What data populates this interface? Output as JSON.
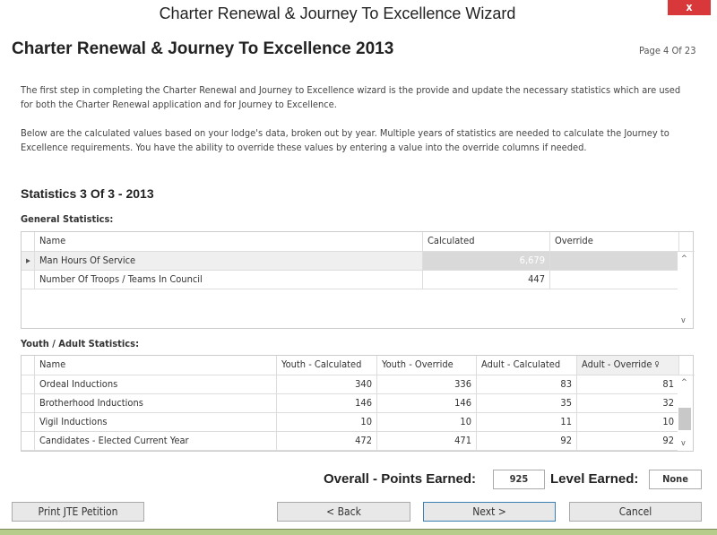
{
  "window": {
    "title": "Charter Renewal & Journey To Excellence Wizard",
    "close": "x"
  },
  "header": {
    "title": "Charter Renewal & Journey To Excellence 2013",
    "page": "Page 4 Of 23"
  },
  "intro": [
    "The first step in completing the Charter Renewal and Journey to Excellence wizard is the provide and update the necessary statistics which are used for both the Charter Renewal application and for Journey to Excellence.",
    "Below are the calculated values based on your lodge's data, broken out by year. Multiple years of statistics are needed to calculate the Journey to Excellence requirements. You have the ability to override these values by entering a value into the override columns if needed."
  ],
  "section": "Statistics 3 Of 3 - 2013",
  "general": {
    "label": "General Statistics:",
    "columns": [
      "Name",
      "Calculated",
      "Override"
    ],
    "rows": [
      {
        "name": "Man Hours Of Service",
        "calc": "6,679",
        "override": ""
      },
      {
        "name": "Number Of Troops / Teams In Council",
        "calc": "447",
        "override": ""
      }
    ]
  },
  "youth": {
    "label": "Youth / Adult Statistics:",
    "columns": [
      "Name",
      "Youth - Calculated",
      "Youth - Override",
      "Adult - Calculated",
      "Adult - Override"
    ],
    "rows": [
      [
        "Ordeal Inductions",
        "340",
        "336",
        "83",
        "81"
      ],
      [
        "Brotherhood Inductions",
        "146",
        "146",
        "35",
        "32"
      ],
      [
        "Vigil Inductions",
        "10",
        "10",
        "11",
        "10"
      ],
      [
        "Candidates - Elected Current Year",
        "472",
        "471",
        "92",
        "92"
      ]
    ]
  },
  "totals": {
    "points_label": "Overall - Points Earned:",
    "points": "925",
    "level_label": "Level Earned:",
    "level": "None"
  },
  "buttons": {
    "print": "Print JTE Petition",
    "back": "< Back",
    "next": "Next >",
    "cancel": "Cancel"
  }
}
